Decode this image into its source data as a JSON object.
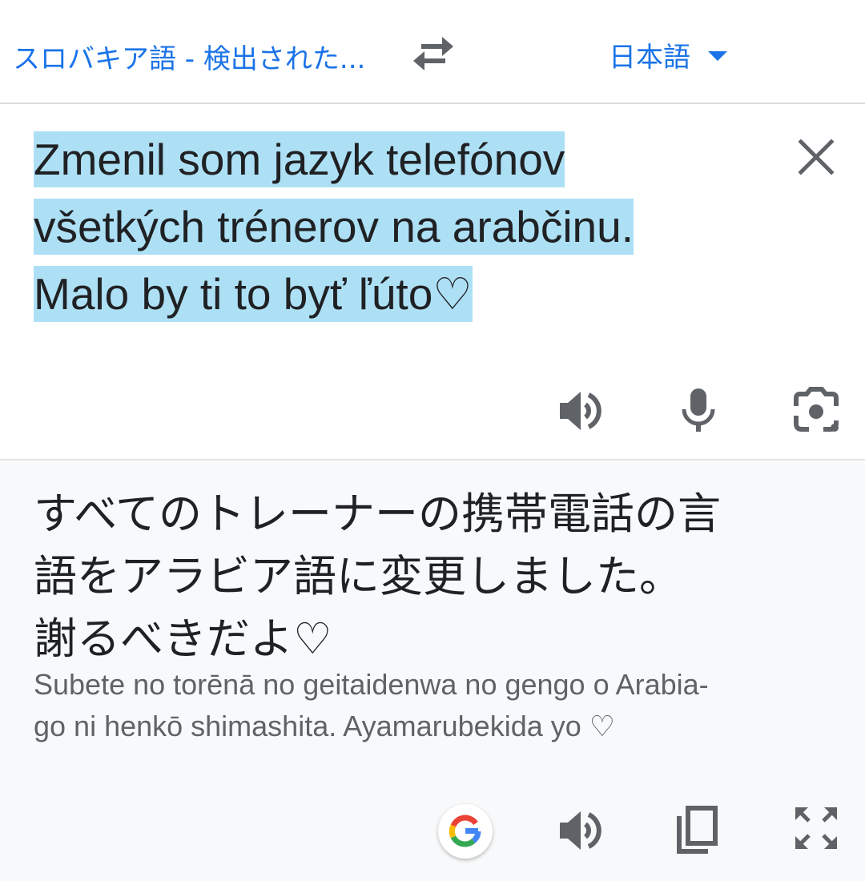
{
  "header": {
    "source_language": "スロバキア語 - 検出された...",
    "target_language": "日本語"
  },
  "source": {
    "lines": [
      "Zmenil som jazyk telefónov",
      "všetkých trénerov na arabčinu.",
      "Malo by ti to byť ľúto♡"
    ]
  },
  "translation": {
    "lines": [
      "すべてのトレーナーの携帯電話の言",
      "語をアラビア語に変更しました。",
      "謝るべきだよ♡"
    ],
    "romanization_lines": [
      "Subete no torēnā no geitaidenwa no gengo o Arabia-",
      "go ni henkō shimashita. Ayamarubekida yo ♡"
    ]
  },
  "colors": {
    "accent": "#1a73e8",
    "highlight": "#ade0f5",
    "icon": "#5f6368",
    "target_bg": "#f8f9fa"
  }
}
